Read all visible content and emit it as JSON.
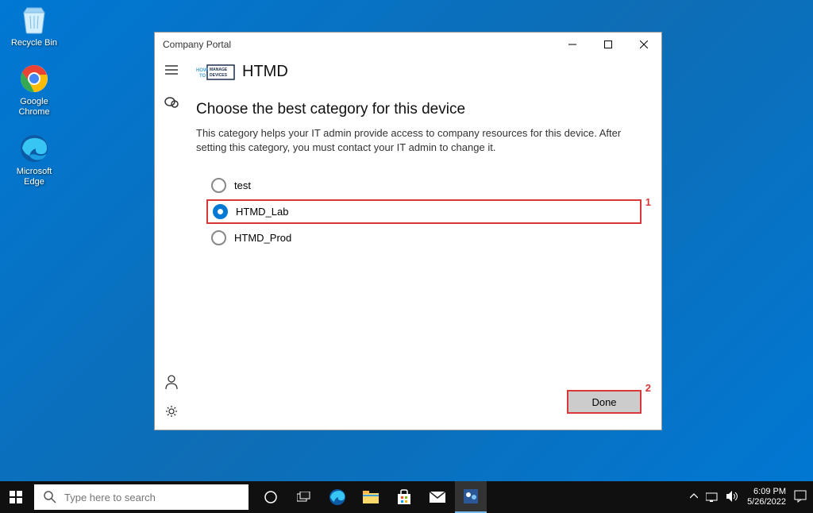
{
  "desktop": {
    "icons": [
      {
        "label": "Recycle Bin"
      },
      {
        "label": "Google Chrome"
      },
      {
        "label": "Microsoft Edge"
      }
    ]
  },
  "window": {
    "title": "Company Portal",
    "app_name": "HTMD",
    "page_title": "Choose the best category for this device",
    "page_description": "This category helps your IT admin provide access to company resources for this device. After setting this category, you must contact your IT admin to change it.",
    "categories": [
      {
        "label": "test",
        "selected": false
      },
      {
        "label": "HTMD_Lab",
        "selected": true
      },
      {
        "label": "HTMD_Prod",
        "selected": false
      }
    ],
    "done_button": "Done",
    "annotations": {
      "opt2": "1",
      "done": "2"
    }
  },
  "taskbar": {
    "search_placeholder": "Type here to search",
    "time": "6:09 PM",
    "date": "5/26/2022"
  }
}
